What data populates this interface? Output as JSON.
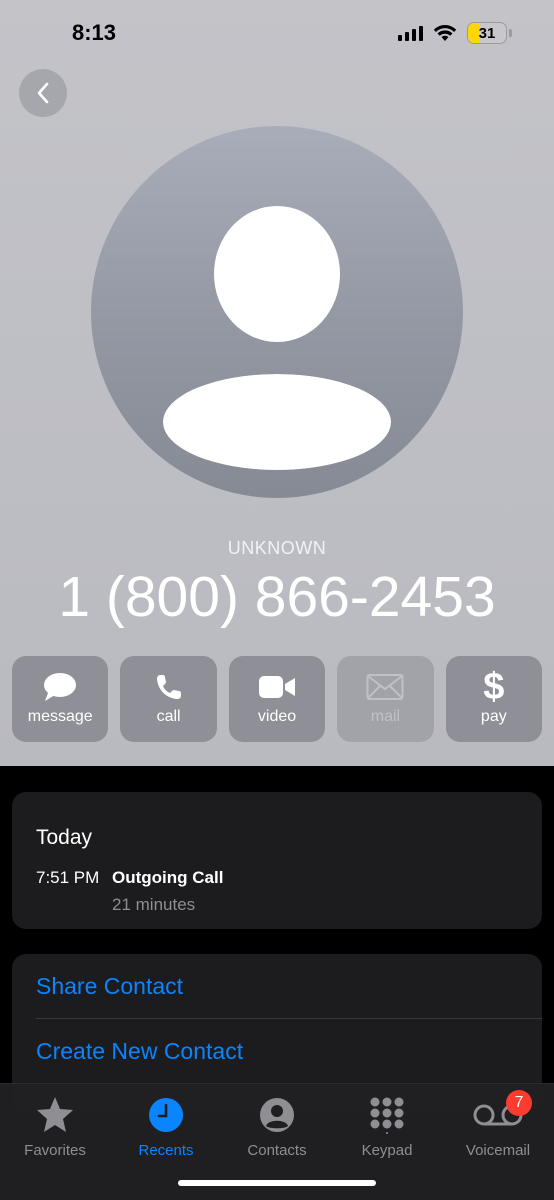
{
  "status_bar": {
    "time": "8:13",
    "battery_level": "31"
  },
  "contact": {
    "label": "UNKNOWN",
    "number": "1 (800) 866-2453"
  },
  "actions": [
    {
      "label": "message",
      "icon": "message-icon",
      "enabled": true
    },
    {
      "label": "call",
      "icon": "phone-icon",
      "enabled": true
    },
    {
      "label": "video",
      "icon": "video-icon",
      "enabled": true
    },
    {
      "label": "mail",
      "icon": "mail-icon",
      "enabled": false
    },
    {
      "label": "pay",
      "icon": "dollar-icon",
      "enabled": true
    }
  ],
  "recents": {
    "title": "Today",
    "entries": [
      {
        "time": "7:51 PM",
        "type": "Outgoing Call",
        "duration": "21 minutes"
      }
    ]
  },
  "options": [
    {
      "label": "Share Contact"
    },
    {
      "label": "Create New Contact"
    }
  ],
  "tabs": [
    {
      "label": "Favorites",
      "icon": "star-icon",
      "active": false
    },
    {
      "label": "Recents",
      "icon": "clock-icon",
      "active": true
    },
    {
      "label": "Contacts",
      "icon": "person-circle-icon",
      "active": false
    },
    {
      "label": "Keypad",
      "icon": "keypad-icon",
      "active": false
    },
    {
      "label": "Voicemail",
      "icon": "voicemail-icon",
      "active": false,
      "badge": "7"
    }
  ],
  "colors": {
    "accent": "#0a84ff",
    "badge": "#ff3b30",
    "battery": "#ffd60a"
  }
}
